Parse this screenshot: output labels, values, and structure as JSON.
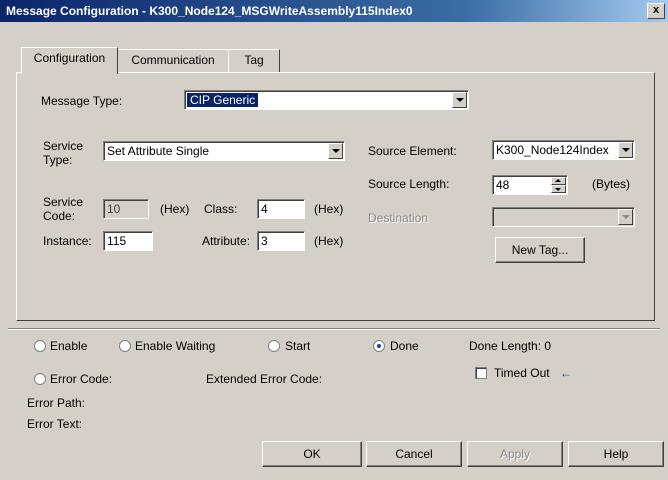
{
  "window": {
    "title": "Message Configuration - K300_Node124_MSGWriteAssembly115Index0",
    "close_glyph": "x"
  },
  "tabs": [
    {
      "label": "Configuration",
      "active": true
    },
    {
      "label": "Communication",
      "active": false
    },
    {
      "label": "Tag",
      "active": false
    }
  ],
  "config": {
    "message_type_label": "Message Type:",
    "message_type_value": "CIP Generic",
    "service_type_label_1": "Service",
    "service_type_label_2": "Type:",
    "service_type_value": "Set Attribute Single",
    "service_code_label_1": "Service",
    "service_code_label_2": "Code:",
    "service_code_value": "10",
    "hex_label": "(Hex)",
    "class_label": "Class:",
    "class_value": "4",
    "instance_label": "Instance:",
    "instance_value": "115",
    "attribute_label": "Attribute:",
    "attribute_value": "3",
    "source_element_label": "Source Element:",
    "source_element_value": "K300_Node124Index",
    "source_length_label": "Source Length:",
    "source_length_value": "48",
    "bytes_label": "(Bytes)",
    "destination_label": "Destination",
    "new_tag_label": "New Tag..."
  },
  "status": {
    "enable_label": "Enable",
    "enable_waiting_label": "Enable Waiting",
    "start_label": "Start",
    "done_label": "Done",
    "done_length_label": "Done Length: 0",
    "error_code_label": "Error Code:",
    "extended_error_code_label": "Extended Error Code:",
    "timed_out_label": "Timed Out",
    "timed_out_arrow": "←",
    "error_path_label": "Error Path:",
    "error_text_label": "Error Text:"
  },
  "buttons": {
    "ok": "OK",
    "cancel": "Cancel",
    "apply": "Apply",
    "help": "Help"
  },
  "colors": {
    "titlebar": "#0a246a",
    "dialog_bg": "#d4d0c8",
    "selection": "#0a246a",
    "radio_on": "#1a3fb8"
  }
}
